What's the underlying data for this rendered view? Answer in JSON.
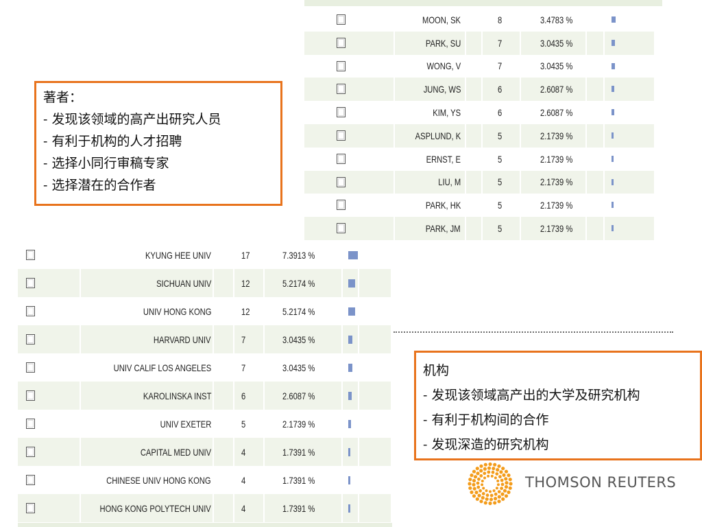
{
  "authors_table": {
    "rows": [
      {
        "name": "MOON, SK",
        "count": "8",
        "percent": "3.4783 %",
        "share": 3.4783
      },
      {
        "name": "PARK, SU",
        "count": "7",
        "percent": "3.0435 %",
        "share": 3.0435
      },
      {
        "name": "WONG, V",
        "count": "7",
        "percent": "3.0435 %",
        "share": 3.0435
      },
      {
        "name": "JUNG, WS",
        "count": "6",
        "percent": "2.6087 %",
        "share": 2.6087
      },
      {
        "name": "KIM, YS",
        "count": "6",
        "percent": "2.6087 %",
        "share": 2.6087
      },
      {
        "name": "ASPLUND, K",
        "count": "5",
        "percent": "2.1739 %",
        "share": 2.1739
      },
      {
        "name": "ERNST, E",
        "count": "5",
        "percent": "2.1739 %",
        "share": 2.1739
      },
      {
        "name": "LIU, M",
        "count": "5",
        "percent": "2.1739 %",
        "share": 2.1739
      },
      {
        "name": "PARK, HK",
        "count": "5",
        "percent": "2.1739 %",
        "share": 2.1739
      },
      {
        "name": "PARK, JM",
        "count": "5",
        "percent": "2.1739 %",
        "share": 2.1739
      }
    ]
  },
  "institutions_table": {
    "rows": [
      {
        "name": "KYUNG HEE UNIV",
        "count": "17",
        "percent": "7.3913 %",
        "share": 7.3913
      },
      {
        "name": "SICHUAN UNIV",
        "count": "12",
        "percent": "5.2174 %",
        "share": 5.2174
      },
      {
        "name": "UNIV HONG KONG",
        "count": "12",
        "percent": "5.2174 %",
        "share": 5.2174
      },
      {
        "name": "HARVARD UNIV",
        "count": "7",
        "percent": "3.0435 %",
        "share": 3.0435
      },
      {
        "name": "UNIV CALIF LOS ANGELES",
        "count": "7",
        "percent": "3.0435 %",
        "share": 3.0435
      },
      {
        "name": "KAROLINSKA INST",
        "count": "6",
        "percent": "2.6087 %",
        "share": 2.6087
      },
      {
        "name": "UNIV EXETER",
        "count": "5",
        "percent": "2.1739 %",
        "share": 2.1739
      },
      {
        "name": "CAPITAL MED UNIV",
        "count": "4",
        "percent": "1.7391 %",
        "share": 1.7391
      },
      {
        "name": "CHINESE UNIV HONG KONG",
        "count": "4",
        "percent": "1.7391 %",
        "share": 1.7391
      },
      {
        "name": "HONG KONG POLYTECH UNIV",
        "count": "4",
        "percent": "1.7391 %",
        "share": 1.7391
      }
    ]
  },
  "authors_callout": {
    "title": "著者：",
    "lines": [
      "- 发现该领域的高产出研究人员",
      "- 有利于机构的人才招聘",
      "- 选择小同行审稿专家",
      "- 选择潜在的合作者"
    ]
  },
  "institutions_callout": {
    "title": "机构",
    "lines": [
      "- 发现该领域高产出的大学及研究机构",
      "- 有利于机构间的合作",
      "- 发现深造的研究机构"
    ]
  },
  "logo": {
    "text": "THOMSON REUTERS",
    "icon": "thomson-reuters-logo-icon"
  },
  "colors": {
    "accent": "#e8731c",
    "bar": "#7b93c9",
    "row_shade": "#f0f4ea",
    "logo_orange": "#f39c1b"
  }
}
